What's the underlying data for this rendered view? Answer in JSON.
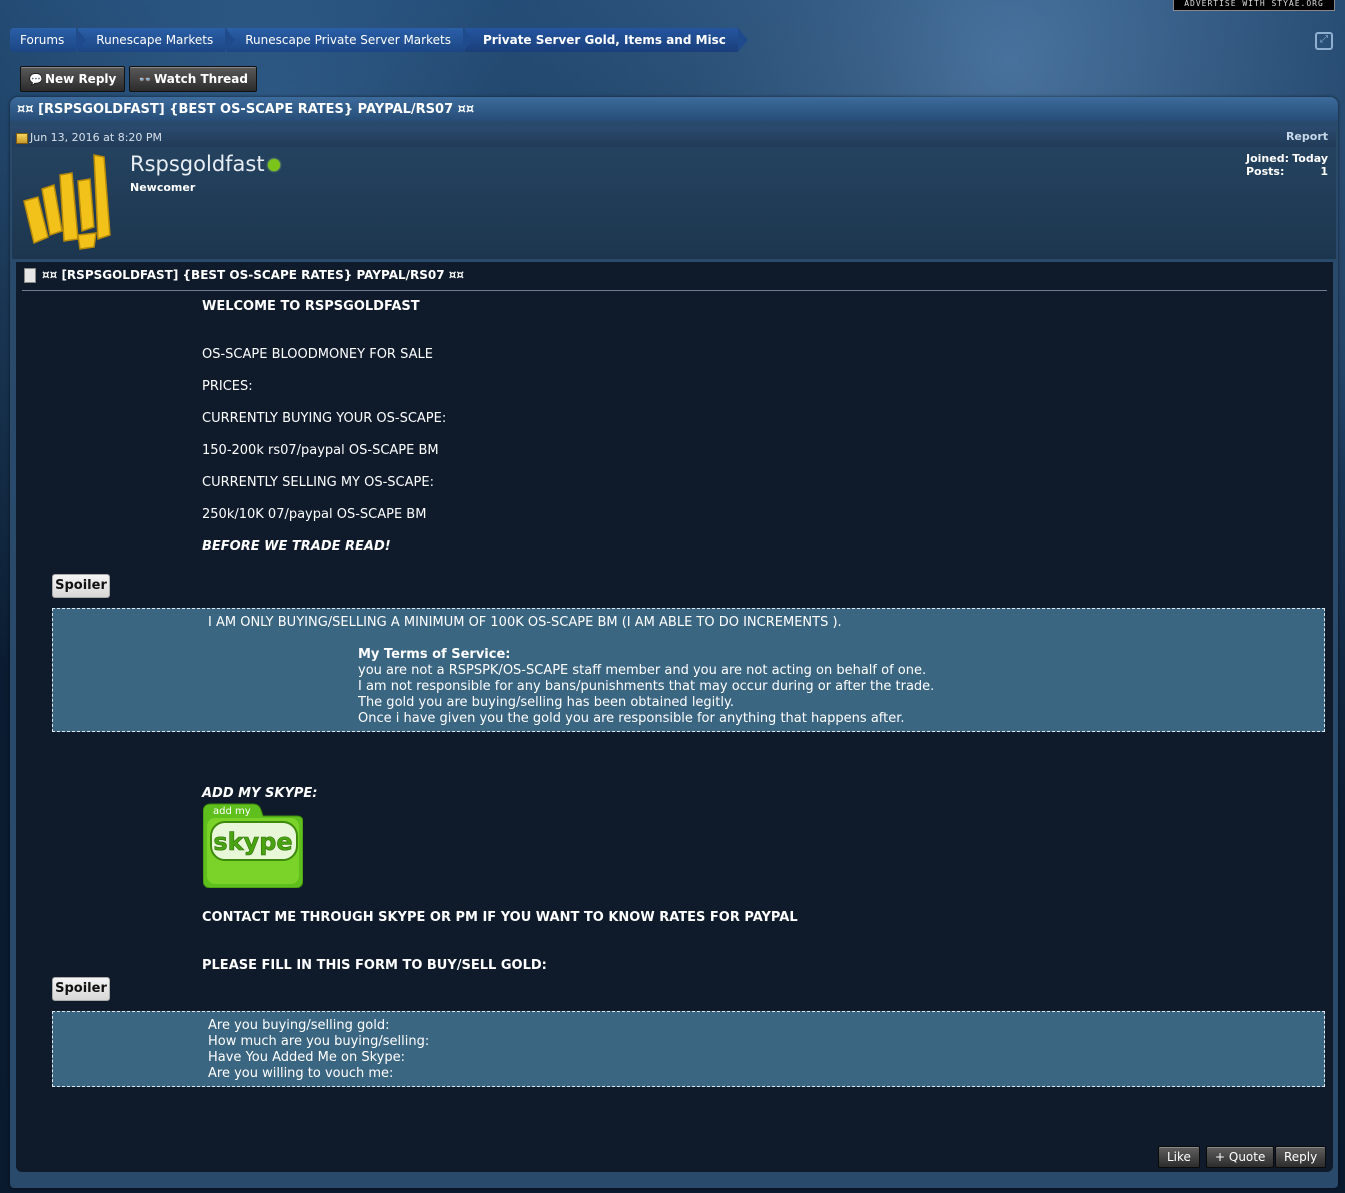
{
  "ad_strip": "ADVERTISE WITH STYAE.ORG",
  "breadcrumbs": [
    "Forums",
    "Runescape Markets",
    "Runescape Private Server Markets",
    "Private Server Gold, Items and Misc"
  ],
  "actions": {
    "new_reply": "New Reply",
    "watch_thread": "Watch Thread"
  },
  "thread": {
    "title": "¤¤ [RSPSGOLDFAST] {BEST OS-SCAPE RATES} PAYPAL/RS07 ¤¤"
  },
  "post": {
    "date": "Jun 13, 2016 at 8:20 PM",
    "report": "Report",
    "author": "Rspsgoldfast",
    "author_title": "Newcomer",
    "stats": {
      "joined_label": "Joined:",
      "joined_value": "Today",
      "posts_label": "Posts:",
      "posts_value": "1"
    },
    "heading": "¤¤ [RSPSGOLDFAST] {BEST OS-SCAPE RATES} PAYPAL/RS07 ¤¤",
    "lines": {
      "welcome": "WELCOME TO RSPSGOLDFAST",
      "for_sale": "OS-SCAPE BLOODMONEY FOR SALE",
      "prices": "PRICES:",
      "buying": "CURRENTLY BUYING YOUR OS-SCAPE:",
      "buy_rate": "150-200k rs07/paypal OS-SCAPE BM",
      "selling": "CURRENTLY SELLING MY OS-SCAPE:",
      "sell_rate": "250k/10K 07/paypal OS-SCAPE BM",
      "before_trade": "BEFORE WE TRADE READ!",
      "add_skype": "ADD MY SKYPE:",
      "contact": "CONTACT ME THROUGH SKYPE OR PM IF YOU WANT TO KNOW RATES FOR PAYPAL",
      "fill_form": "PLEASE FILL IN THIS FORM TO BUY/SELL GOLD:"
    },
    "spoiler_label": "Spoiler",
    "spoiler1": {
      "minimum": "I AM ONLY BUYING/SELLING A MINIMUM OF 100K OS-SCAPE BM (I AM ABLE TO DO INCREMENTS ).",
      "tos_title": "My Terms of Service:",
      "tos": [
        "you are not a RSPSPK/OS-SCAPE staff member and you are not acting on behalf of one.",
        "I am not responsible for any bans/punishments that may occur during or after the trade.",
        "The gold you are buying/selling has been obtained legitly.",
        "Once i have given you the gold you are responsible for anything that happens after."
      ]
    },
    "spoiler2": [
      "Are you buying/selling gold:",
      "How much are you buying/selling:",
      "Have You Added Me on Skype:",
      "Are you willing to vouch me:"
    ],
    "skype_badge": {
      "top_text": "add my",
      "logo_text": "skype"
    },
    "footer": {
      "like": "Like",
      "quote": "+ Quote",
      "reply": "Reply"
    }
  }
}
